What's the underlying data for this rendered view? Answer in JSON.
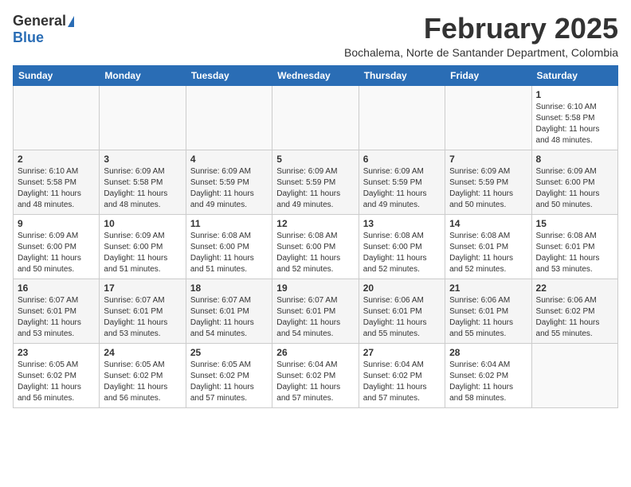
{
  "header": {
    "logo_general": "General",
    "logo_blue": "Blue",
    "month_title": "February 2025",
    "location": "Bochalema, Norte de Santander Department, Colombia"
  },
  "days_of_week": [
    "Sunday",
    "Monday",
    "Tuesday",
    "Wednesday",
    "Thursday",
    "Friday",
    "Saturday"
  ],
  "weeks": [
    [
      {
        "day": "",
        "info": ""
      },
      {
        "day": "",
        "info": ""
      },
      {
        "day": "",
        "info": ""
      },
      {
        "day": "",
        "info": ""
      },
      {
        "day": "",
        "info": ""
      },
      {
        "day": "",
        "info": ""
      },
      {
        "day": "1",
        "info": "Sunrise: 6:10 AM\nSunset: 5:58 PM\nDaylight: 11 hours and 48 minutes."
      }
    ],
    [
      {
        "day": "2",
        "info": "Sunrise: 6:10 AM\nSunset: 5:58 PM\nDaylight: 11 hours and 48 minutes."
      },
      {
        "day": "3",
        "info": "Sunrise: 6:09 AM\nSunset: 5:58 PM\nDaylight: 11 hours and 48 minutes."
      },
      {
        "day": "4",
        "info": "Sunrise: 6:09 AM\nSunset: 5:59 PM\nDaylight: 11 hours and 49 minutes."
      },
      {
        "day": "5",
        "info": "Sunrise: 6:09 AM\nSunset: 5:59 PM\nDaylight: 11 hours and 49 minutes."
      },
      {
        "day": "6",
        "info": "Sunrise: 6:09 AM\nSunset: 5:59 PM\nDaylight: 11 hours and 49 minutes."
      },
      {
        "day": "7",
        "info": "Sunrise: 6:09 AM\nSunset: 5:59 PM\nDaylight: 11 hours and 50 minutes."
      },
      {
        "day": "8",
        "info": "Sunrise: 6:09 AM\nSunset: 6:00 PM\nDaylight: 11 hours and 50 minutes."
      }
    ],
    [
      {
        "day": "9",
        "info": "Sunrise: 6:09 AM\nSunset: 6:00 PM\nDaylight: 11 hours and 50 minutes."
      },
      {
        "day": "10",
        "info": "Sunrise: 6:09 AM\nSunset: 6:00 PM\nDaylight: 11 hours and 51 minutes."
      },
      {
        "day": "11",
        "info": "Sunrise: 6:08 AM\nSunset: 6:00 PM\nDaylight: 11 hours and 51 minutes."
      },
      {
        "day": "12",
        "info": "Sunrise: 6:08 AM\nSunset: 6:00 PM\nDaylight: 11 hours and 52 minutes."
      },
      {
        "day": "13",
        "info": "Sunrise: 6:08 AM\nSunset: 6:00 PM\nDaylight: 11 hours and 52 minutes."
      },
      {
        "day": "14",
        "info": "Sunrise: 6:08 AM\nSunset: 6:01 PM\nDaylight: 11 hours and 52 minutes."
      },
      {
        "day": "15",
        "info": "Sunrise: 6:08 AM\nSunset: 6:01 PM\nDaylight: 11 hours and 53 minutes."
      }
    ],
    [
      {
        "day": "16",
        "info": "Sunrise: 6:07 AM\nSunset: 6:01 PM\nDaylight: 11 hours and 53 minutes."
      },
      {
        "day": "17",
        "info": "Sunrise: 6:07 AM\nSunset: 6:01 PM\nDaylight: 11 hours and 53 minutes."
      },
      {
        "day": "18",
        "info": "Sunrise: 6:07 AM\nSunset: 6:01 PM\nDaylight: 11 hours and 54 minutes."
      },
      {
        "day": "19",
        "info": "Sunrise: 6:07 AM\nSunset: 6:01 PM\nDaylight: 11 hours and 54 minutes."
      },
      {
        "day": "20",
        "info": "Sunrise: 6:06 AM\nSunset: 6:01 PM\nDaylight: 11 hours and 55 minutes."
      },
      {
        "day": "21",
        "info": "Sunrise: 6:06 AM\nSunset: 6:01 PM\nDaylight: 11 hours and 55 minutes."
      },
      {
        "day": "22",
        "info": "Sunrise: 6:06 AM\nSunset: 6:02 PM\nDaylight: 11 hours and 55 minutes."
      }
    ],
    [
      {
        "day": "23",
        "info": "Sunrise: 6:05 AM\nSunset: 6:02 PM\nDaylight: 11 hours and 56 minutes."
      },
      {
        "day": "24",
        "info": "Sunrise: 6:05 AM\nSunset: 6:02 PM\nDaylight: 11 hours and 56 minutes."
      },
      {
        "day": "25",
        "info": "Sunrise: 6:05 AM\nSunset: 6:02 PM\nDaylight: 11 hours and 57 minutes."
      },
      {
        "day": "26",
        "info": "Sunrise: 6:04 AM\nSunset: 6:02 PM\nDaylight: 11 hours and 57 minutes."
      },
      {
        "day": "27",
        "info": "Sunrise: 6:04 AM\nSunset: 6:02 PM\nDaylight: 11 hours and 57 minutes."
      },
      {
        "day": "28",
        "info": "Sunrise: 6:04 AM\nSunset: 6:02 PM\nDaylight: 11 hours and 58 minutes."
      },
      {
        "day": "",
        "info": ""
      }
    ]
  ]
}
